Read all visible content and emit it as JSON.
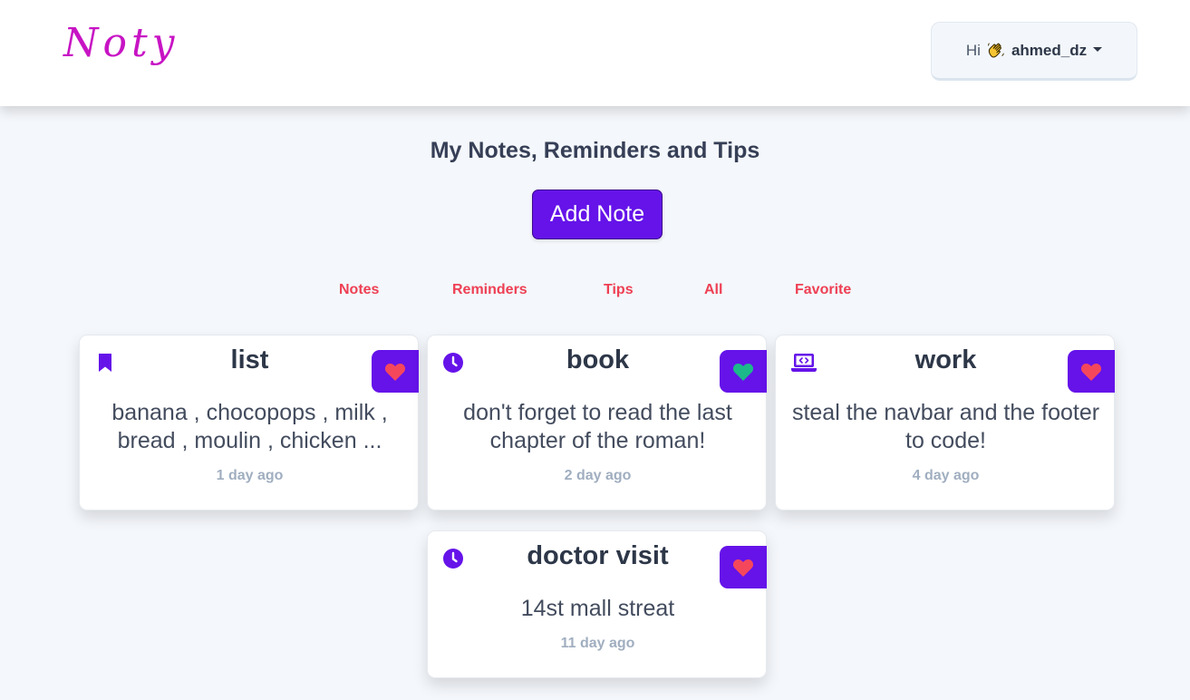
{
  "brand": {
    "logo": "Noty",
    "color": "#c714c4"
  },
  "user_menu": {
    "greeting": "Hi",
    "emoji": "waving-hand-icon",
    "username": "ahmed_dz"
  },
  "main": {
    "heading": "My Notes, Reminders and Tips",
    "add_button": "Add Note",
    "accent": "#6513e9"
  },
  "filters": [
    {
      "label": "Notes"
    },
    {
      "label": "Reminders"
    },
    {
      "label": "Tips"
    },
    {
      "label": "All"
    },
    {
      "label": "Favorite"
    }
  ],
  "notes": [
    {
      "type_icon": "bookmark-icon",
      "title": "list",
      "body": "banana , chocopops , milk , bread , moulin , chicken ...",
      "time": "1 day ago",
      "favorite_color": "#f5475c"
    },
    {
      "type_icon": "clock-icon",
      "title": "book",
      "body": "don't forget to read the last chapter of the roman!",
      "time": "2 day ago",
      "favorite_color": "#1cb98a"
    },
    {
      "type_icon": "laptop-code-icon",
      "title": "work",
      "body": "steal the navbar and the footer to code!",
      "time": "4 day ago",
      "favorite_color": "#f5475c"
    },
    {
      "type_icon": "clock-icon",
      "title": "doctor visit",
      "body": "14st mall streat",
      "time": "11 day ago",
      "favorite_color": "#f5475c"
    }
  ]
}
